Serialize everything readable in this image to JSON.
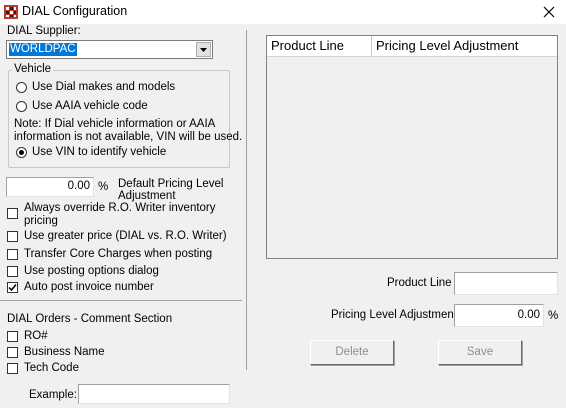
{
  "window": {
    "title": "DIAL Configuration"
  },
  "supplier": {
    "label": "DIAL Supplier:",
    "selected": "WORLDPAC"
  },
  "vehicle": {
    "group_label": "Vehicle",
    "options": [
      {
        "label": "Use Dial makes and models",
        "checked": false
      },
      {
        "label": "Use AAIA vehicle code",
        "checked": false
      },
      {
        "label": "Use VIN to identify vehicle",
        "checked": true
      }
    ],
    "note_line1": "Note: If Dial vehicle information or AAIA",
    "note_line2": "information is not available, VIN will be used."
  },
  "pricing": {
    "value": "0.00",
    "percent": "%",
    "label_line1": "Default Pricing Level",
    "label_line2": "Adjustment"
  },
  "options": [
    {
      "label_line1": "Always override R.O. Writer inventory",
      "label_line2": "pricing",
      "checked": false
    },
    {
      "label_line1": "Use greater price (DIAL vs. R.O. Writer)",
      "checked": false
    },
    {
      "label_line1": "Transfer Core Charges when posting",
      "checked": false
    },
    {
      "label_line1": "Use posting options dialog",
      "checked": false
    },
    {
      "label_line1": "Auto post invoice number",
      "checked": true
    }
  ],
  "comment_section": {
    "title": "DIAL Orders - Comment Section",
    "items": [
      {
        "label": "RO#",
        "checked": false
      },
      {
        "label": "Business Name",
        "checked": false
      },
      {
        "label": "Tech Code",
        "checked": false
      }
    ],
    "example_label": "Example:",
    "example_value": ""
  },
  "table": {
    "columns": [
      "Product Line",
      "Pricing Level Adjustment"
    ],
    "rows": []
  },
  "form": {
    "product_line_label": "Product Line",
    "product_line_value": "",
    "pricing_adj_label": "Pricing Level Adjustment",
    "pricing_adj_value": "0.00",
    "percent": "%"
  },
  "buttons": {
    "delete": "Delete",
    "save": "Save"
  },
  "icons": [
    "app-icon",
    "close-icon",
    "chevron-down-icon",
    "check-icon"
  ],
  "colors": {
    "selection": "#0078d7",
    "window_bg": "#f0f0f0",
    "disabled_text": "#8d8d8d"
  }
}
